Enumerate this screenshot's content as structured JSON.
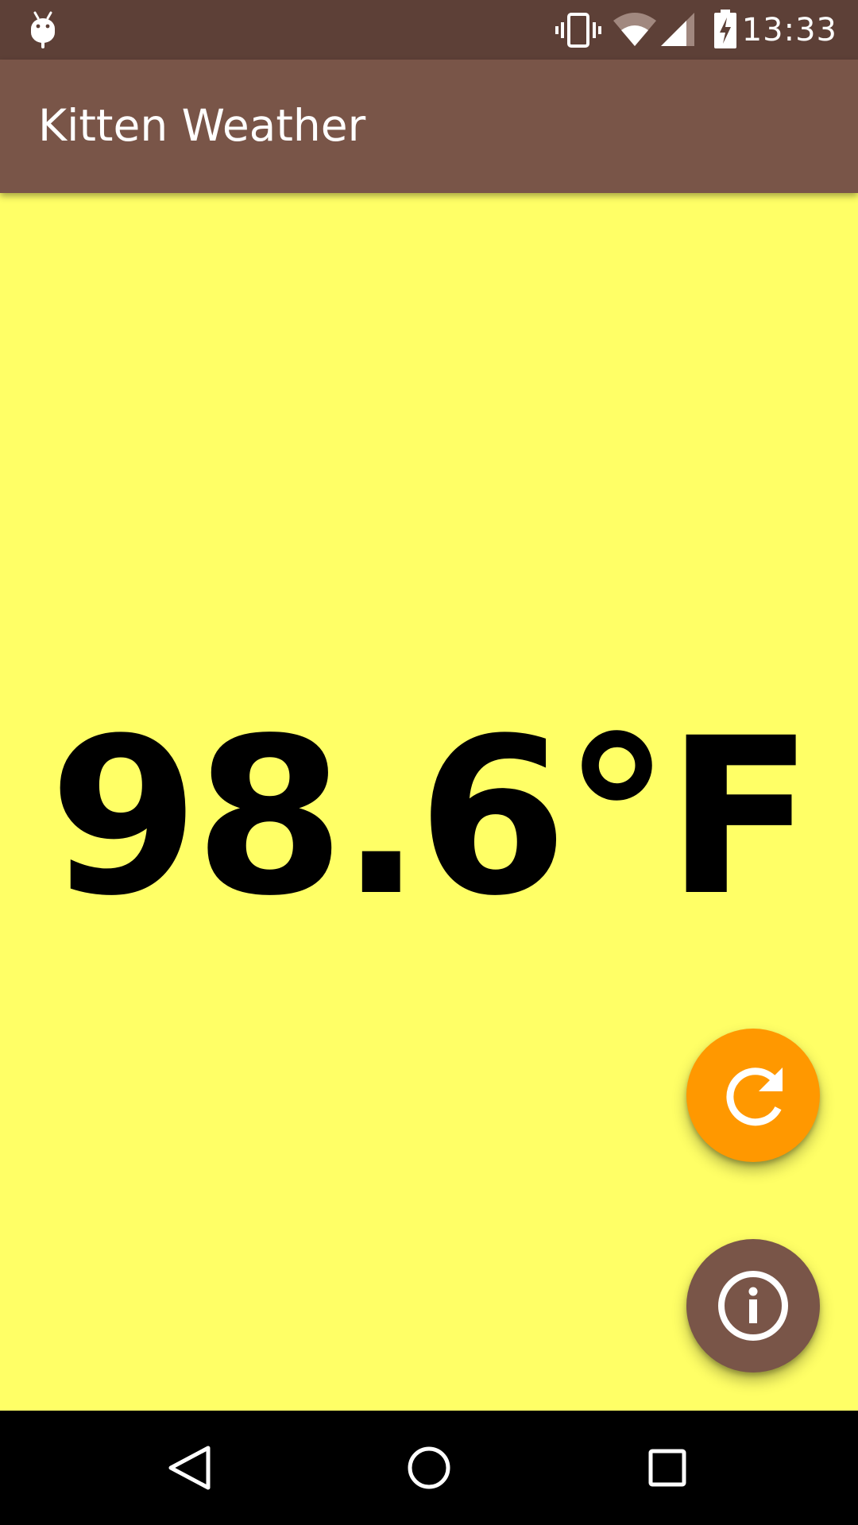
{
  "status_bar": {
    "time": "13:33",
    "icons": [
      "android-debug-icon",
      "vibrate-icon",
      "wifi-icon",
      "cell-signal-icon",
      "battery-charging-icon"
    ]
  },
  "app_bar": {
    "title": "Kitten Weather"
  },
  "main": {
    "temperature": "98.6°F"
  },
  "fabs": {
    "refresh_icon": "refresh-icon",
    "info_icon": "info-icon"
  },
  "nav_bar": {
    "icons": [
      "back-icon",
      "home-icon",
      "recents-icon"
    ]
  },
  "colors": {
    "status_bar": "#5d4037",
    "app_bar": "#795548",
    "background": "#ffff66",
    "refresh_fab": "#ff9800",
    "info_fab": "#795548",
    "nav_bar": "#000000"
  }
}
